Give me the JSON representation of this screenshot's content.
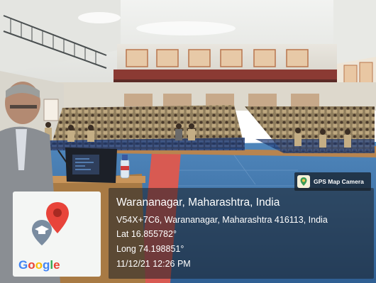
{
  "gps_overlay": {
    "app_badge": "GPS Map Camera",
    "location_title": "Warananagar, Maharashtra, India",
    "address": "V54X+7C6, Warananagar, Maharashtra 416113, India",
    "latitude": "Lat 16.855782°",
    "longitude": "Long 74.198851°",
    "datetime": "11/12/21 12:26 PM"
  },
  "map_thumbnail": {
    "logo_letters": [
      "G",
      "o",
      "o",
      "g",
      "l",
      "e"
    ],
    "logo_colors": [
      "#4285F4",
      "#EA4335",
      "#FBBC05",
      "#4285F4",
      "#34A853",
      "#EA4335"
    ],
    "pin_icon": "red-location-pin",
    "marker_icon": "graduation-cap-marker"
  },
  "colors": {
    "hall_floor_blue": "#3b72a8",
    "stage_floor_red": "#d85a52",
    "uniform_khaki": "#b9a27a",
    "chairs_navy": "#233a6b"
  }
}
